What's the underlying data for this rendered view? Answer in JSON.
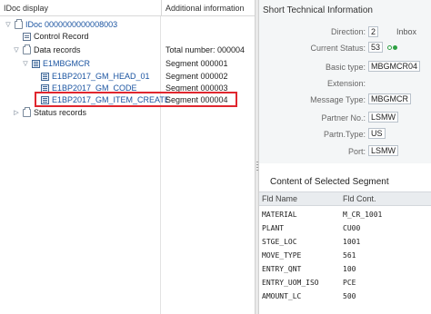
{
  "tree_pane": {
    "col_idoc": "IDoc display",
    "col_info": "Additional information",
    "nodes": [
      {
        "label": "IDoc 0000000000008003",
        "info": ""
      },
      {
        "label": "Control Record",
        "info": ""
      },
      {
        "label": "Data records",
        "info": "Total number: 000004"
      },
      {
        "label": "E1MBGMCR",
        "info": "Segment 000001"
      },
      {
        "label": "E1BP2017_GM_HEAD_01",
        "info": "Segment 000002"
      },
      {
        "label": "E1BP2017_GM_CODE",
        "info": "Segment 000003"
      },
      {
        "label": "E1BP2017_GM_ITEM_CREATE",
        "info": "Segment 000004"
      },
      {
        "label": "Status records",
        "info": ""
      }
    ],
    "highlight_color": "#e0262e"
  },
  "tech_info": {
    "title": "Short Technical Information",
    "direction_label": "Direction:",
    "direction_value": "2",
    "direction_text": "Inbox",
    "status_label": "Current Status:",
    "status_value": "53",
    "basic_type_label": "Basic type:",
    "basic_type_value": "MBGMCR04",
    "extension_label": "Extension:",
    "extension_value": "",
    "message_type_label": "Message Type:",
    "message_type_value": "MBGMCR",
    "partner_no_label": "Partner No.:",
    "partner_no_value": "LSMW",
    "partn_type_label": "Partn.Type:",
    "partn_type_value": "US",
    "port_label": "Port:",
    "port_value": "LSMW",
    "status_icon": "green-light-icon",
    "status_color": "#2ea043"
  },
  "segment": {
    "title": "Content of Selected Segment",
    "col_name": "Fld Name",
    "col_value": "Fld Cont.",
    "fields": [
      {
        "name": "MATERIAL",
        "value": "M_CR_1001"
      },
      {
        "name": "PLANT",
        "value": "CU00"
      },
      {
        "name": "STGE_LOC",
        "value": "1001"
      },
      {
        "name": "MOVE_TYPE",
        "value": "561"
      },
      {
        "name": "ENTRY_QNT",
        "value": "100"
      },
      {
        "name": "ENTRY_UOM_ISO",
        "value": "PCE"
      },
      {
        "name": "AMOUNT_LC",
        "value": "500"
      }
    ]
  }
}
